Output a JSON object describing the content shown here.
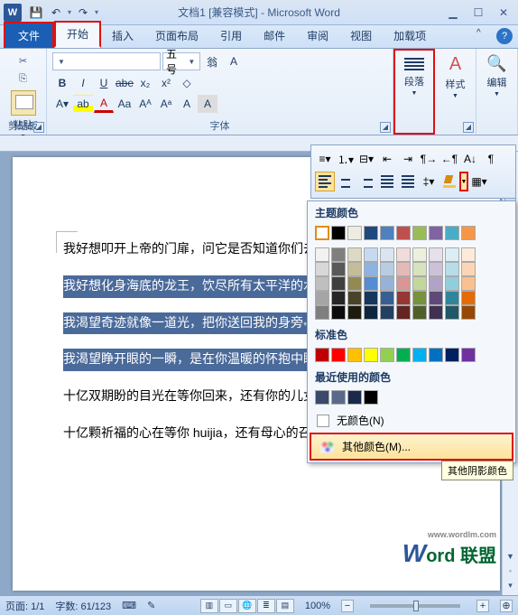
{
  "title": "文档1 [兼容模式] - Microsoft Word",
  "app_initial": "W",
  "qat": {
    "save": "💾",
    "undo": "↶",
    "redo": "↷",
    "more": "▾"
  },
  "win": {
    "min": "▁",
    "max": "☐",
    "close": "✕"
  },
  "tabs": {
    "file": "文件",
    "home": "开始",
    "insert": "插入",
    "layout": "页面布局",
    "ref": "引用",
    "mail": "邮件",
    "review": "审阅",
    "view": "视图",
    "addin": "加载项"
  },
  "help": "?",
  "ribbon": {
    "clipboard": {
      "label": "剪贴板",
      "paste": "粘贴"
    },
    "font": {
      "label": "字体",
      "name": "",
      "size": "五号",
      "btns": {
        "bold": "B",
        "italic": "I",
        "underline": "U",
        "strike": "abe",
        "sub": "x₂",
        "sup": "x²",
        "clear": "◇",
        "phonetic": "拼",
        "border": "▭",
        "highlight": "ab",
        "color": "A",
        "grow": "Aᴬ",
        "shrink": "Aᵃ",
        "change": "Aa",
        "charfx": "A",
        "charborder": "A",
        "charshade": "A",
        "asian": "翁",
        "asian2": "A"
      }
    },
    "para": {
      "label": "段落",
      "icon_lines": 4
    },
    "style": {
      "label": "样式",
      "icon": "A"
    },
    "edit": {
      "label": "编辑",
      "icon": "🔍"
    }
  },
  "mini_toolbar": {
    "row1": [
      "list-bullet",
      "list-number",
      "list-multi",
      "indent-dec",
      "indent-inc",
      "sort",
      "show-marks"
    ],
    "row2_align": [
      "left",
      "center",
      "right",
      "justify",
      "distribute"
    ],
    "row2_other": [
      "line-spacing"
    ]
  },
  "color_dropdown": {
    "theme_label": "主题颜色",
    "theme_row1": [
      "#ffffff",
      "#000000",
      "#eeece1",
      "#1f497d",
      "#4f81bd",
      "#c0504d",
      "#9bbb59",
      "#8064a2",
      "#4bacc6",
      "#f79646"
    ],
    "theme_shades": [
      [
        "#f2f2f2",
        "#7f7f7f",
        "#ddd9c3",
        "#c6d9f0",
        "#dbe5f1",
        "#f2dcdb",
        "#ebf1dd",
        "#e5e0ec",
        "#dbeef3",
        "#fdeada"
      ],
      [
        "#d8d8d8",
        "#595959",
        "#c4bd97",
        "#8db3e2",
        "#b8cce4",
        "#e5b9b7",
        "#d7e3bc",
        "#ccc1d9",
        "#b7dde8",
        "#fbd5b5"
      ],
      [
        "#bfbfbf",
        "#3f3f3f",
        "#938953",
        "#548dd4",
        "#95b3d7",
        "#d99694",
        "#c3d69b",
        "#b2a2c7",
        "#92cddc",
        "#fac08f"
      ],
      [
        "#a5a5a5",
        "#262626",
        "#494429",
        "#17365d",
        "#366092",
        "#953734",
        "#76923c",
        "#5f497a",
        "#31859b",
        "#e36c09"
      ],
      [
        "#7f7f7f",
        "#0c0c0c",
        "#1d1b10",
        "#0f243e",
        "#244061",
        "#632423",
        "#4f6128",
        "#3f3151",
        "#205867",
        "#974806"
      ]
    ],
    "standard_label": "标准色",
    "standard": [
      "#c00000",
      "#ff0000",
      "#ffc000",
      "#ffff00",
      "#92d050",
      "#00b050",
      "#00b0f0",
      "#0070c0",
      "#002060",
      "#7030a0"
    ],
    "recent_label": "最近使用的颜色",
    "recent": [
      "#3a4a6b",
      "#5a6a8b",
      "#1a2a4b",
      "#000000"
    ],
    "no_color": "无颜色(N)",
    "more_colors": "其他颜色(M)...",
    "tooltip": "其他阴影颜色"
  },
  "document": {
    "p1": "我好想叩开上帝的门扉，问它是否知道你们去了何方",
    "p2": "我好想化身海底的龙王，饮尽所有太平洋的水域",
    "p3": "我渴望奇迹就像一道光，把你送回我的身旁",
    "p4": "我渴望睁开眼的一瞬，是在你温暖的怀抱中睡醒",
    "p5": "十亿双期盼的目光在等你回来，还有你的儿女",
    "p6": "十亿颗祈福的心在等你 huijia，还有母心的召唤",
    "pm": "↵"
  },
  "status": {
    "page": "页面: 1/1",
    "words": "字数: 61/123",
    "lang_ic": "⌨",
    "insert_ic": "✎",
    "zoom": "100%"
  },
  "watermark": {
    "site": "www.wordlm.com",
    "brand_w": "W",
    "brand_rest": "ord 联盟"
  }
}
